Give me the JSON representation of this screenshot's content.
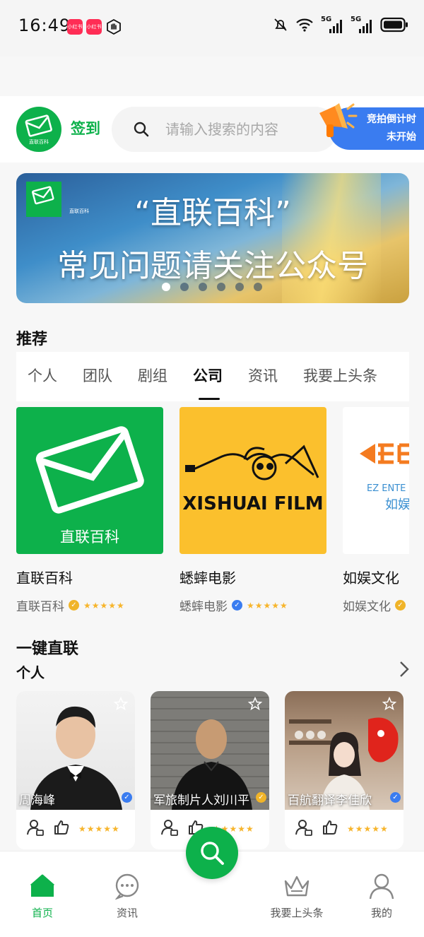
{
  "status_bar": {
    "time": "16:49",
    "app_badge_1": "小红书",
    "app_badge_2": "小红书",
    "signal_1": "5G",
    "signal_2": "5G"
  },
  "header": {
    "logo_caption": "直联百科",
    "checkin_label": "签到",
    "search_placeholder": "请输入搜索的内容",
    "auction_line1": "竞拍倒计时",
    "auction_line2": "未开始"
  },
  "banner": {
    "logo_caption": "直联百科",
    "title": "“直联百科”",
    "subtitle": "常见问题请关注公众号",
    "active_dot": 0,
    "dot_count": 6
  },
  "recommend": {
    "title": "推荐",
    "tabs": [
      "个人",
      "团队",
      "剧组",
      "公司",
      "资讯",
      "我要上头条"
    ],
    "active_tab": "公司",
    "cards": [
      {
        "image_caption": "直联百科",
        "name": "直联百科",
        "company": "直联百科",
        "badge_color": "#f0b429",
        "stars": "★★★★★"
      },
      {
        "image_caption": "XISHUAI FILM",
        "name": "蟋蟀电影",
        "company": "蟋蟀电影",
        "badge_color": "#3a7cf0",
        "stars": "★★★★★"
      },
      {
        "image_caption": "EZ ENTE",
        "image_caption_2": "如娱",
        "name": "如娱文化",
        "company": "如娱文化",
        "badge_color": "#f0b429",
        "stars": "★★★★★"
      }
    ]
  },
  "direct": {
    "title": "一键直联",
    "subtitle": "个人",
    "people": [
      {
        "name": "周海峰",
        "stars": "★★★★★",
        "badge_color": "#3a7cf0"
      },
      {
        "name": "军旅制片人刘川平",
        "stars": "★★★★★",
        "badge_color": "#f0b429"
      },
      {
        "name": "百航翻译李佳欣",
        "stars": "★★★★★",
        "badge_color": "#3a7cf0"
      }
    ]
  },
  "bottom_nav": {
    "items": [
      {
        "label": "首页",
        "icon": "home-icon"
      },
      {
        "label": "资讯",
        "icon": "chat-bubble-icon"
      },
      {
        "label": "我要上头条",
        "icon": "crown-icon"
      },
      {
        "label": "我的",
        "icon": "person-icon"
      }
    ],
    "active": "首页",
    "center_action": "search-icon"
  },
  "colors": {
    "brand_green": "#0db14b",
    "accent_blue": "#3a7cf0",
    "star_gold": "#f7b52c",
    "film_yellow": "#fbc02d"
  }
}
